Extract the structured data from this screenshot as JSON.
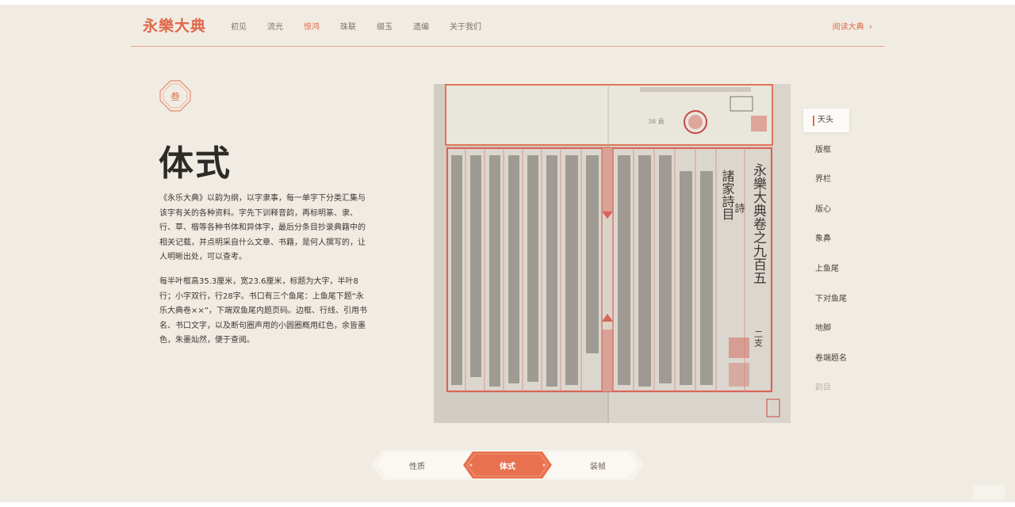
{
  "header": {
    "logo": "永樂大典",
    "nav": [
      "初见",
      "流光",
      "惊鸿",
      "珠联",
      "缀玉",
      "遗编",
      "关于我们"
    ],
    "active_nav": "惊鸿",
    "read_button": "阅读大典",
    "read_chevron": "›"
  },
  "section": {
    "badge": "叁",
    "title": "体式",
    "paragraph1": "《永乐大典》以韵为纲，以字隶事，每一单字下分类汇集与该字有关的各种资料。字先下训释音韵，再标明篆、隶、行、草、楷等各种书体和异体字，最后分条目抄录典籍中的相关记载，并点明采自什么文章、书籍，是何人撰写的，让人明晰出处，可以查考。",
    "paragraph2": "每半叶框高35.3厘米，宽23.6厘米，标题为大字，半叶8行；小字双行，行28字。书口有三个鱼尾：上鱼尾下题“永乐大典卷××”，下端双鱼尾内题页码。边框、行线、引用书名、书口文字，以及断句圈声用的小圆圈概用红色，余皆墨色，朱墨灿然，便于查阅。"
  },
  "image": {
    "right_page_title": "永樂大典卷之九百五",
    "sub_title": "諸家詩目",
    "side_char": "詩",
    "bottom_chars": "二支"
  },
  "toc": {
    "items": [
      "天头",
      "版框",
      "界栏",
      "版心",
      "象鼻",
      "上鱼尾",
      "下对鱼尾",
      "地脚",
      "卷端题名",
      "韵目"
    ],
    "active": "天头"
  },
  "tabs": {
    "items": [
      "性质",
      "体式",
      "装帧"
    ],
    "active": "体式"
  },
  "colors": {
    "accent": "#e06a4a",
    "background": "#f1ece3",
    "paper": "#d8d3ca"
  }
}
